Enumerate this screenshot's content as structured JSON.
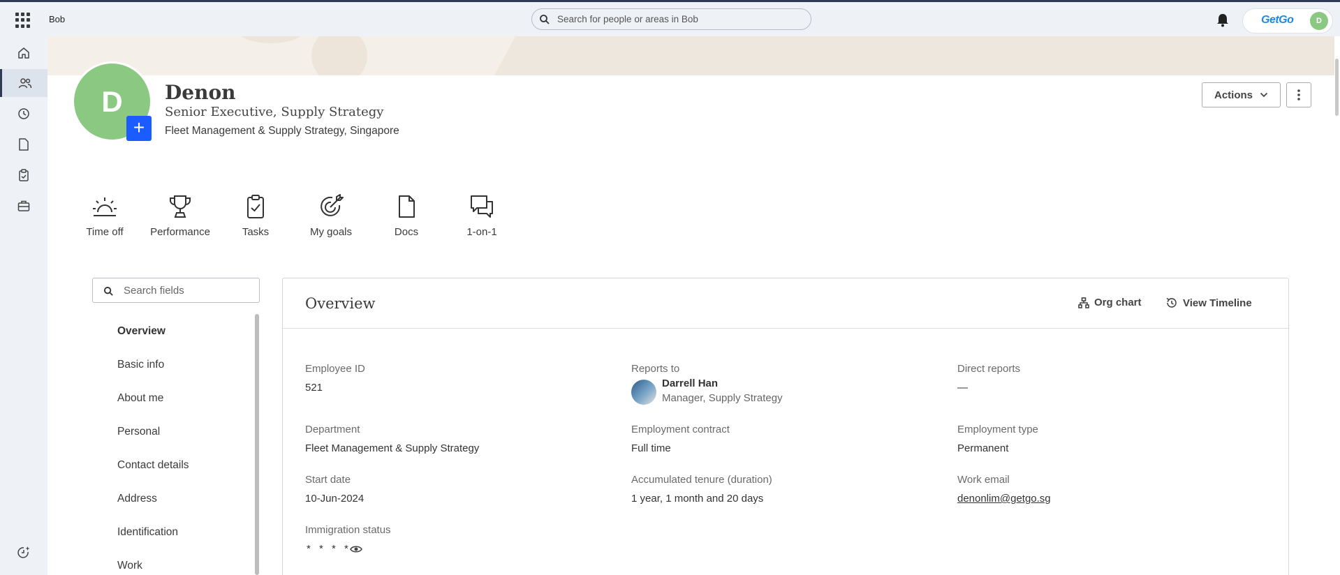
{
  "topbar": {
    "app_name": "Bob",
    "search_placeholder": "Search for people or areas in Bob",
    "brand_logo": "GetGo",
    "user_initial": "D"
  },
  "rail": [
    "home-icon",
    "people-icon",
    "clock-icon",
    "document-icon",
    "clipboard-icon",
    "briefcase-icon",
    "whats-new-icon"
  ],
  "profile": {
    "initial": "D",
    "name": "Denon",
    "title": "Senior Executive, Supply Strategy",
    "department_location": "Fleet Management & Supply Strategy, Singapore",
    "actions_label": "Actions"
  },
  "quick_links": [
    {
      "label": "Time off",
      "icon": "sunrise-icon"
    },
    {
      "label": "Performance",
      "icon": "trophy-icon"
    },
    {
      "label": "Tasks",
      "icon": "clipboard-check-icon"
    },
    {
      "label": "My goals",
      "icon": "target-icon"
    },
    {
      "label": "Docs",
      "icon": "doc-icon"
    },
    {
      "label": "1-on-1",
      "icon": "chat-bubbles-icon"
    }
  ],
  "sidebar": {
    "search_placeholder": "Search fields",
    "items": [
      "Overview",
      "Basic info",
      "About me",
      "Personal",
      "Contact details",
      "Address",
      "Identification",
      "Work"
    ],
    "active": "Overview"
  },
  "overview": {
    "title": "Overview",
    "org_chart_label": "Org chart",
    "timeline_label": "View Timeline",
    "fields": {
      "employee_id": {
        "label": "Employee ID",
        "value": "521"
      },
      "reports_to": {
        "label": "Reports to",
        "name": "Darrell Han",
        "role": "Manager, Supply Strategy"
      },
      "direct_reports": {
        "label": "Direct reports",
        "value": "—"
      },
      "department": {
        "label": "Department",
        "value": "Fleet Management & Supply Strategy"
      },
      "employment_contract": {
        "label": "Employment contract",
        "value": "Full time"
      },
      "employment_type": {
        "label": "Employment type",
        "value": "Permanent"
      },
      "start_date": {
        "label": "Start date",
        "value": "10-Jun-2024"
      },
      "tenure": {
        "label": "Accumulated tenure (duration)",
        "value": "1 year, 1 month and 20 days"
      },
      "work_email": {
        "label": "Work email",
        "value": "denonlim@getgo.sg"
      },
      "immigration_status": {
        "label": "Immigration status",
        "value": "* * * *"
      }
    }
  }
}
